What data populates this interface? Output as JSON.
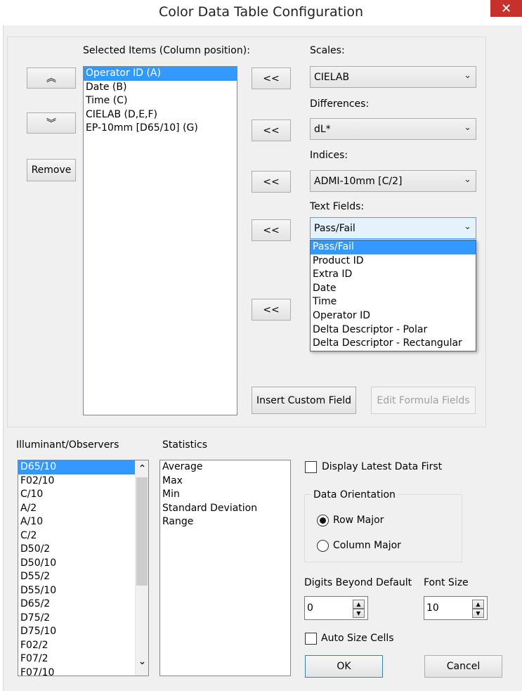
{
  "window": {
    "title": "Color Data Table Configuration",
    "close_glyph": "✕"
  },
  "selected_items": {
    "label": "Selected Items (Column position):",
    "items": [
      "Operator ID (A)",
      "Date (B)",
      "Time (C)",
      "CIELAB (D,E,F)",
      "EP-10mm [D65/10] (G)"
    ],
    "selected_index": 0
  },
  "move_buttons": {
    "up_glyph": "︽",
    "down_glyph": "︾",
    "remove_label": "Remove"
  },
  "add_button_glyph": "<<",
  "scales": {
    "label": "Scales:",
    "value": "CIELAB"
  },
  "differences": {
    "label": "Differences:",
    "value": "dL*"
  },
  "indices": {
    "label": "Indices:",
    "value": "ADMI-10mm [C/2]"
  },
  "text_fields": {
    "label": "Text Fields:",
    "value": "Pass/Fail",
    "options": [
      "Pass/Fail",
      "Product ID",
      "Extra ID",
      "Date",
      "Time",
      "Operator ID",
      "Delta Descriptor - Polar",
      "Delta Descriptor - Rectangular"
    ],
    "highlighted_index": 0
  },
  "chevron_glyph": "⌄",
  "insert_custom_field_label": "Insert Custom Field",
  "edit_formula_fields_label": "Edit Formula Fields",
  "illuminant_observers": {
    "label": "Illuminant/Observers",
    "items": [
      "D65/10",
      "F02/10",
      "C/10",
      "A/2",
      "A/10",
      "C/2",
      "D50/2",
      "D50/10",
      "D55/2",
      "D55/10",
      "D65/2",
      "D75/2",
      "D75/10",
      "F02/2",
      "F07/2",
      "F07/10"
    ],
    "selected_index": 0,
    "scroll_up_glyph": "⌃",
    "scroll_down_glyph": "⌄"
  },
  "statistics": {
    "label": "Statistics",
    "items": [
      "Average",
      "Max",
      "Min",
      "Standard Deviation",
      "Range"
    ]
  },
  "display_latest_first": {
    "label": "Display Latest Data First",
    "checked": false
  },
  "data_orientation": {
    "label": "Data Orientation",
    "row_major": "Row Major",
    "column_major": "Column Major",
    "selected": "Row Major"
  },
  "digits_beyond_default": {
    "label": "Digits Beyond Default",
    "value": "0"
  },
  "font_size": {
    "label": "Font Size",
    "value": "10"
  },
  "spin_up_glyph": "▲",
  "spin_down_glyph": "▼",
  "auto_size_cells": {
    "label": "Auto Size Cells",
    "checked": false
  },
  "ok_label": "OK",
  "cancel_label": "Cancel",
  "colors": {
    "selection": "#3399ff",
    "close_button": "#c7302b",
    "dialog_bg": "#f0f0f0"
  }
}
